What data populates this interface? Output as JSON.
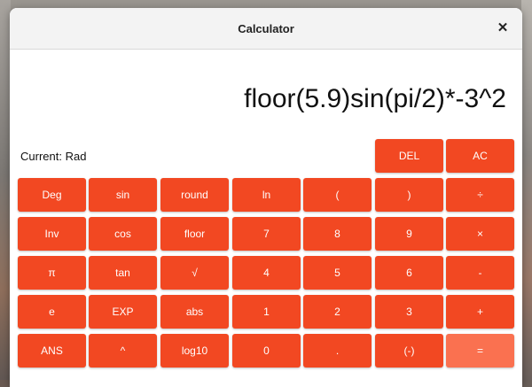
{
  "window": {
    "title": "Calculator",
    "close_symbol": "✕"
  },
  "display": {
    "expression": "floor(5.9)sin(pi/2)*-3^2"
  },
  "mode": {
    "label": "Current: Rad"
  },
  "top_buttons": [
    {
      "label": "DEL"
    },
    {
      "label": "AC"
    }
  ],
  "rows": [
    [
      {
        "label": "Deg"
      },
      {
        "label": "sin"
      },
      {
        "label": "round"
      },
      {
        "label": "ln"
      },
      {
        "label": "("
      },
      {
        "label": ")"
      },
      {
        "label": "÷"
      }
    ],
    [
      {
        "label": "Inv"
      },
      {
        "label": "cos"
      },
      {
        "label": "floor"
      },
      {
        "label": "7"
      },
      {
        "label": "8"
      },
      {
        "label": "9"
      },
      {
        "label": "×"
      }
    ],
    [
      {
        "label": "π"
      },
      {
        "label": "tan"
      },
      {
        "label": "√"
      },
      {
        "label": "4"
      },
      {
        "label": "5"
      },
      {
        "label": "6"
      },
      {
        "label": "-"
      }
    ],
    [
      {
        "label": "e"
      },
      {
        "label": "EXP"
      },
      {
        "label": "abs"
      },
      {
        "label": "1"
      },
      {
        "label": "2"
      },
      {
        "label": "3"
      },
      {
        "label": "+"
      }
    ],
    [
      {
        "label": "ANS"
      },
      {
        "label": "^"
      },
      {
        "label": "log10"
      },
      {
        "label": "0"
      },
      {
        "label": "."
      },
      {
        "label": "(-)"
      },
      {
        "label": "="
      }
    ]
  ],
  "colors": {
    "button": "#f24822",
    "equals": "#fa7150"
  }
}
